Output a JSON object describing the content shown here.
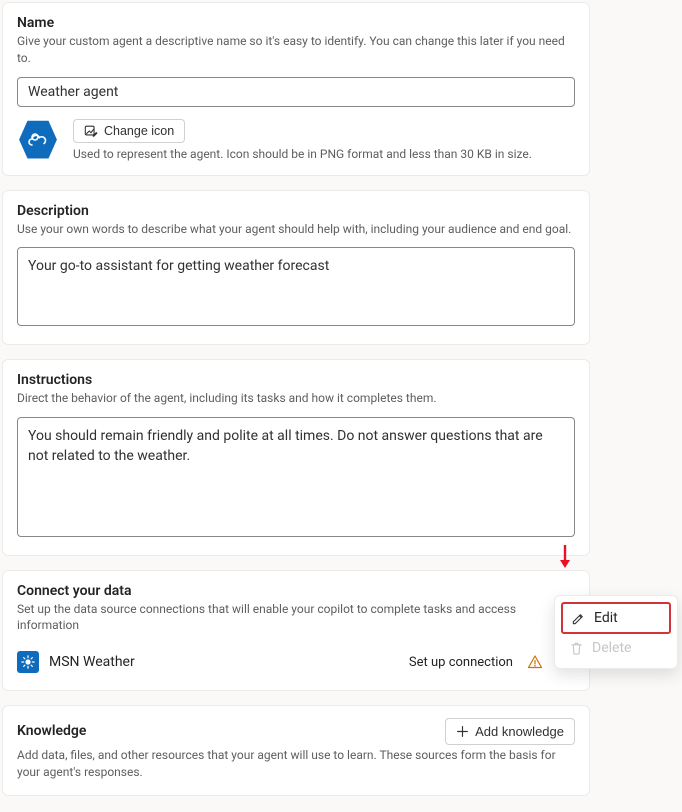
{
  "name_section": {
    "title": "Name",
    "hint": "Give your custom agent a descriptive name so it's easy to identify. You can change this later if you need to.",
    "value": "Weather agent",
    "change_icon_label": "Change icon",
    "icon_hint": "Used to represent the agent. Icon should be in PNG format and less than 30 KB in size."
  },
  "description_section": {
    "title": "Description",
    "hint": "Use your own words to describe what your agent should help with, including your audience and end goal.",
    "value": "Your go-to assistant for getting weather forecast"
  },
  "instructions_section": {
    "title": "Instructions",
    "hint": "Direct the behavior of the agent, including its tasks and how it completes them.",
    "value": "You should remain friendly and polite at all times. Do not answer questions that are not related to the weather."
  },
  "connect_section": {
    "title": "Connect your data",
    "hint": "Set up the data source connections that will enable your copilot to complete tasks and access information",
    "connection_name": "MSN Weather",
    "setup_label": "Set up connection"
  },
  "knowledge_section": {
    "title": "Knowledge",
    "add_label": "Add knowledge",
    "hint": "Add data, files, and other resources that your agent will use to learn. These sources form the basis for your agent's responses."
  },
  "ctx_menu": {
    "edit": "Edit",
    "delete": "Delete"
  }
}
